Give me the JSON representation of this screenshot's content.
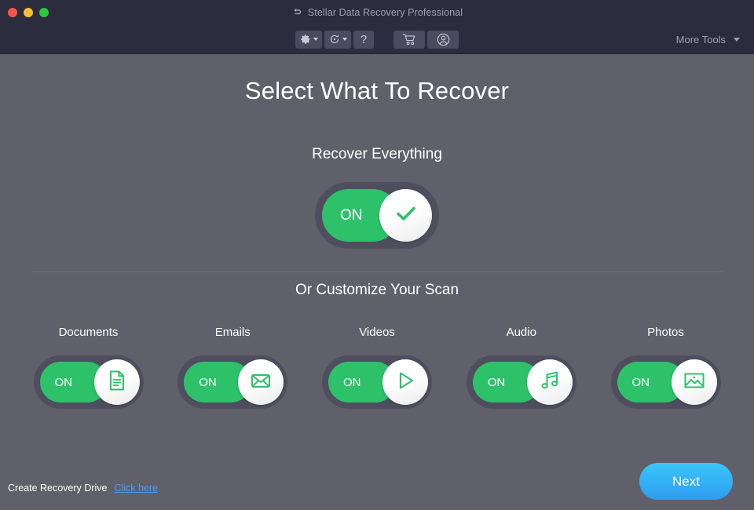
{
  "window": {
    "title": "Stellar Data Recovery Professional",
    "back_icon": "back-arrow-icon",
    "traffic_lights": [
      {
        "name": "close-button",
        "color": "#f9544b"
      },
      {
        "name": "minimize-button",
        "color": "#f8bf33"
      },
      {
        "name": "maximize-button",
        "color": "#2dc93f"
      }
    ]
  },
  "toolbar": {
    "settings_icon": "gear-icon",
    "history_icon": "history-clock-icon",
    "help_label": "?",
    "cart_icon": "shopping-cart-icon",
    "account_icon": "user-account-icon",
    "more_tools_label": "More Tools",
    "more_tools_caret": "chevron-down-icon"
  },
  "main": {
    "page_title": "Select What To Recover",
    "recover_everything": {
      "label": "Recover Everything",
      "toggle_state": "ON",
      "knob_icon": "checkmark-icon"
    },
    "customize_title": "Or Customize Your Scan",
    "categories": [
      {
        "label": "Documents",
        "toggle_state": "ON",
        "icon": "document-icon"
      },
      {
        "label": "Emails",
        "toggle_state": "ON",
        "icon": "envelope-icon"
      },
      {
        "label": "Videos",
        "toggle_state": "ON",
        "icon": "play-triangle-icon"
      },
      {
        "label": "Audio",
        "toggle_state": "ON",
        "icon": "music-note-icon"
      },
      {
        "label": "Photos",
        "toggle_state": "ON",
        "icon": "image-picture-icon"
      }
    ]
  },
  "footer": {
    "recovery_drive_label": "Create Recovery Drive",
    "recovery_drive_link": "Click here",
    "next_label": "Next"
  },
  "colors": {
    "window_chrome": "#2b2c3e",
    "background": "#60606b",
    "toggle_track_on": "#2dc16a",
    "toggle_frame": "#4e4e5e",
    "accent_green": "#2dc16a",
    "link_blue": "#4a9bf5",
    "next_button_blue": "#2f9cf0"
  }
}
